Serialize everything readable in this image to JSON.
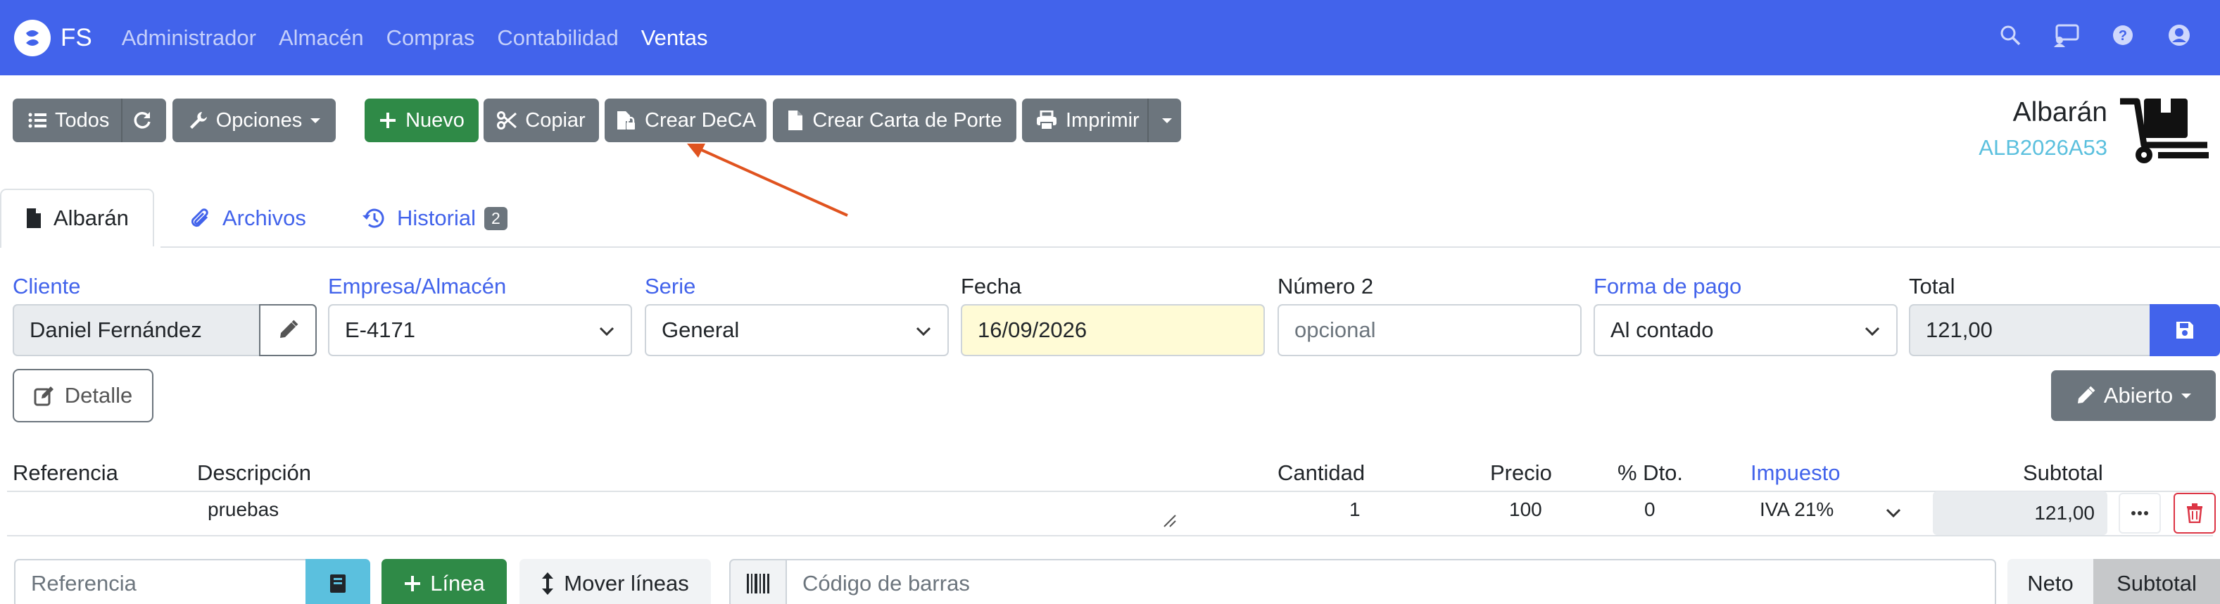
{
  "navbar": {
    "brand": "FS",
    "menu": [
      "Administrador",
      "Almacén",
      "Compras",
      "Contabilidad",
      "Ventas"
    ],
    "active": "Ventas",
    "icons": [
      "search-icon",
      "chat-icon",
      "help-icon",
      "user-icon"
    ]
  },
  "toolbar": {
    "all": "Todos",
    "options": "Opciones",
    "new": "Nuevo",
    "copy": "Copiar",
    "create_deca": "Crear DeCA",
    "create_carta": "Crear Carta de Porte",
    "print": "Imprimir"
  },
  "document": {
    "title": "Albarán",
    "code": "ALB2026A53"
  },
  "tabs": [
    {
      "label": "Albarán"
    },
    {
      "label": "Archivos"
    },
    {
      "label": "Historial",
      "badge": "2"
    }
  ],
  "form": {
    "cliente_label": "Cliente",
    "cliente_value": "Daniel Fernández",
    "empresa_label": "Empresa/Almacén",
    "empresa_value": "E-4171",
    "serie_label": "Serie",
    "serie_value": "General",
    "fecha_label": "Fecha",
    "fecha_value": "16/09/2026",
    "numero2_label": "Número 2",
    "numero2_placeholder": "opcional",
    "forma_pago_label": "Forma de pago",
    "forma_pago_value": "Al contado",
    "total_label": "Total",
    "total_value": "121,00",
    "detalle": "Detalle",
    "abierto": "Abierto"
  },
  "lines": {
    "headers": [
      "Referencia",
      "Descripción",
      "Cantidad",
      "Precio",
      "% Dto.",
      "Impuesto",
      "Subtotal"
    ],
    "rows": [
      {
        "referencia": "",
        "descripcion": "pruebas",
        "cantidad": "1",
        "precio": "100",
        "dto": "0",
        "impuesto": "IVA 21%",
        "subtotal": "121,00"
      }
    ]
  },
  "bottom": {
    "referencia_placeholder": "Referencia",
    "linea": "Línea",
    "mover": "Mover líneas",
    "barcode_placeholder": "Código de barras",
    "neto": "Neto",
    "subtotal": "Subtotal"
  },
  "colors": {
    "navbar": "#4263eb",
    "primary": "#4263eb",
    "success": "#2f8a47",
    "secondary": "#6c757d",
    "info": "#5bc0de",
    "danger": "#dc3545",
    "annotation_arrow": "#e0531f"
  }
}
